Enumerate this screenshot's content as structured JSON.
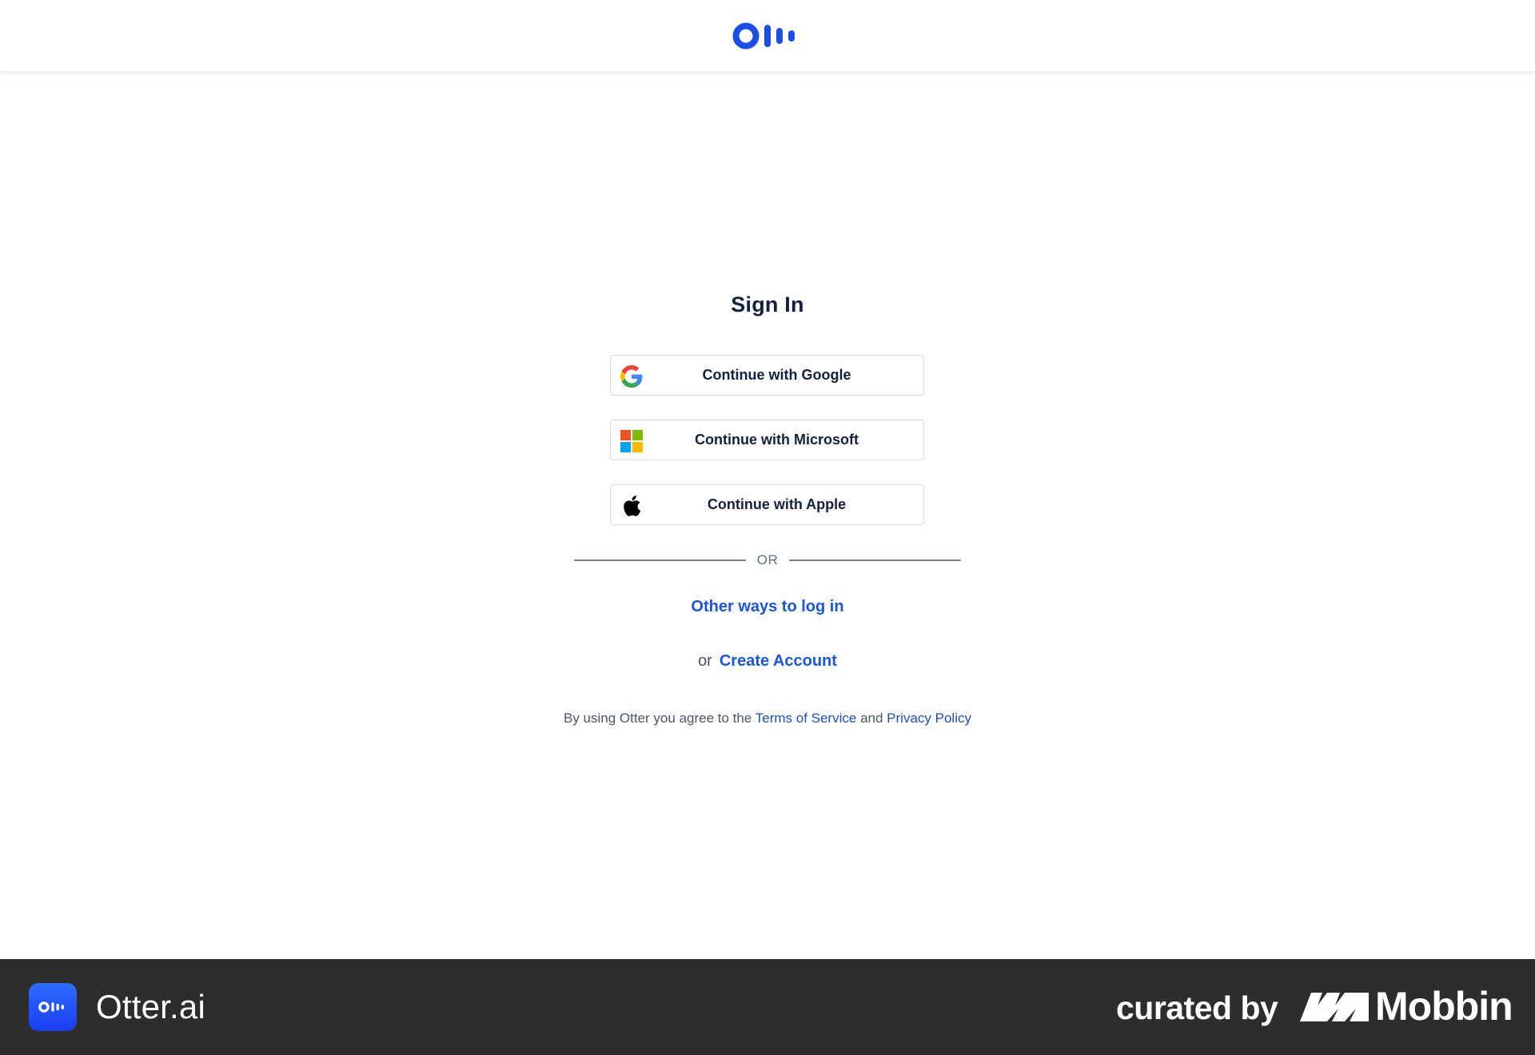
{
  "header": {
    "logo_icon": "otter-logo-icon",
    "brand_color": "#1a4ee6"
  },
  "signin": {
    "title": "Sign In",
    "google_label": "Continue with Google",
    "microsoft_label": "Continue with Microsoft",
    "apple_label": "Continue with Apple",
    "divider_text": "OR",
    "other_ways_label": "Other ways to log in",
    "or_label": "or",
    "create_account_label": "Create Account",
    "terms_prefix": "By using Otter you agree to the",
    "terms_link": "Terms of Service",
    "terms_and": "and",
    "privacy_link": "Privacy Policy"
  },
  "footer": {
    "app_icon": "otter-app-icon",
    "app_name": "Otter.ai",
    "curated_label": "curated by",
    "mobbin_icon": "mobbin-logo-icon",
    "mobbin_name": "Mobbin",
    "background": "#2d2d2d"
  },
  "colors": {
    "link": "#1a56db",
    "title": "#14213d",
    "button_border": "#d5dbe3"
  }
}
